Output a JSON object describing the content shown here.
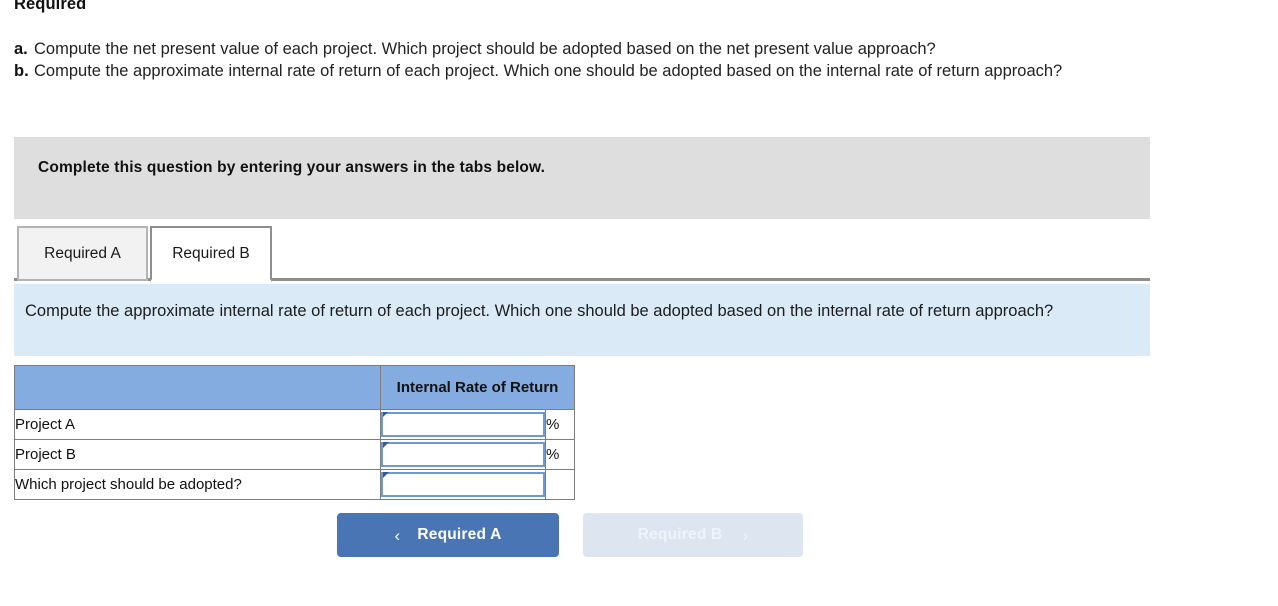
{
  "heading": "Required",
  "requirements": [
    {
      "marker": "a.",
      "text": "Compute the net present value of each project. Which project should be adopted based on the net present value approach?"
    },
    {
      "marker": "b.",
      "text": "Compute the approximate internal rate of return of each project. Which one should be adopted based on the internal rate of return approach?"
    }
  ],
  "banner": {
    "text": "Complete this question by entering your answers in the tabs below."
  },
  "tabs": [
    {
      "label": "Required A",
      "state": "inactive"
    },
    {
      "label": "Required B",
      "state": "active"
    }
  ],
  "panel": {
    "text": "Compute the approximate internal rate of return of each project. Which one should be adopted based on the internal rate of return approach?"
  },
  "table": {
    "headers": [
      "",
      "Internal Rate of Return",
      ""
    ],
    "rows": [
      {
        "label": "Project A",
        "value": "",
        "suffix": "%"
      },
      {
        "label": "Project B",
        "value": "",
        "suffix": "%"
      },
      {
        "label": "Which project should be adopted?",
        "value": "",
        "suffix": ""
      }
    ]
  },
  "nav": {
    "prev_label": "Required A",
    "prev_icon": "chevron-left-icon",
    "prev_glyph": "‹",
    "next_label": "Required B",
    "next_icon": "chevron-right-icon",
    "next_glyph": "›"
  },
  "colors": {
    "banner_gray": "#dedede",
    "panel_blue": "#dbeaf7",
    "table_header_blue": "#84ace0",
    "input_border_blue": "#6f9ad1",
    "button_active_blue": "#4a75b5",
    "button_disabled_blue": "#dce5f0"
  }
}
